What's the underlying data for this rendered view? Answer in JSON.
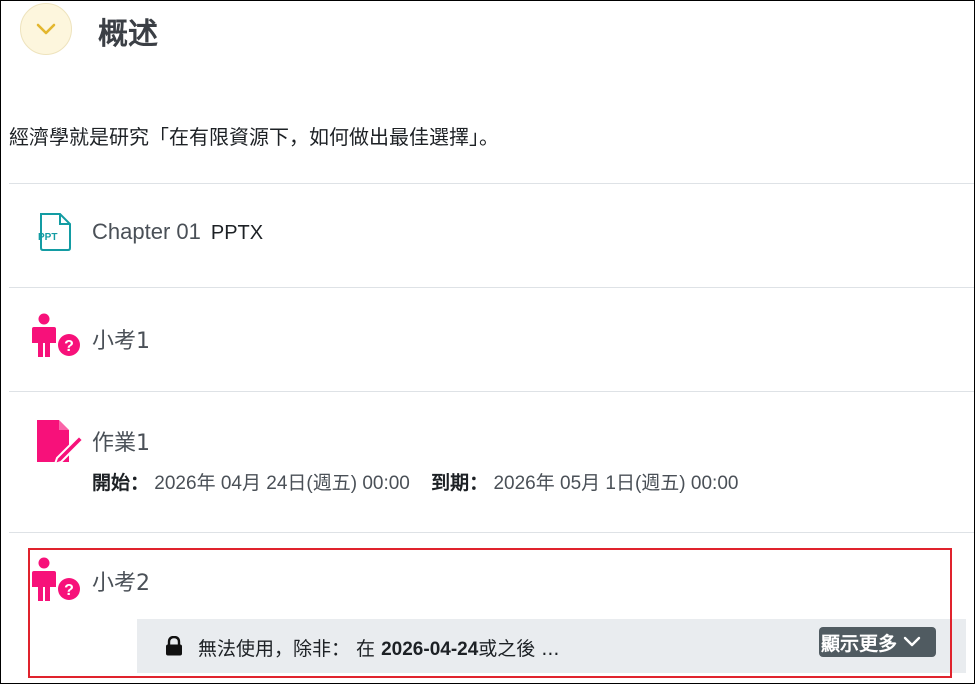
{
  "section": {
    "title": "概述",
    "summary": "經濟學就是研究「在有限資源下，如何做出最佳選擇」。"
  },
  "activities": [
    {
      "type": "resource",
      "icon": "ppt-file-icon",
      "name": "Chapter 01",
      "ext": "PPTX"
    },
    {
      "type": "quiz",
      "icon": "quiz-icon",
      "name": "小考1"
    },
    {
      "type": "assignment",
      "icon": "assignment-icon",
      "name": "作業1",
      "open_label": "開始：",
      "open_value": "2026年 04月 24日(週五) 00:00",
      "due_label": "到期：",
      "due_value": "2026年 05月 1日(週五) 00:00"
    },
    {
      "type": "quiz",
      "icon": "quiz-icon",
      "name": "小考2",
      "restriction": {
        "prefix": "無法使用，除非： 在 ",
        "date": "2026-04-24",
        "suffix": "或之後 ...",
        "show_more": "顯示更多"
      }
    }
  ],
  "colors": {
    "accent": "#f7117a",
    "ppt": "#139ca3",
    "highlight": "#e0232d",
    "button": "#505b61"
  }
}
